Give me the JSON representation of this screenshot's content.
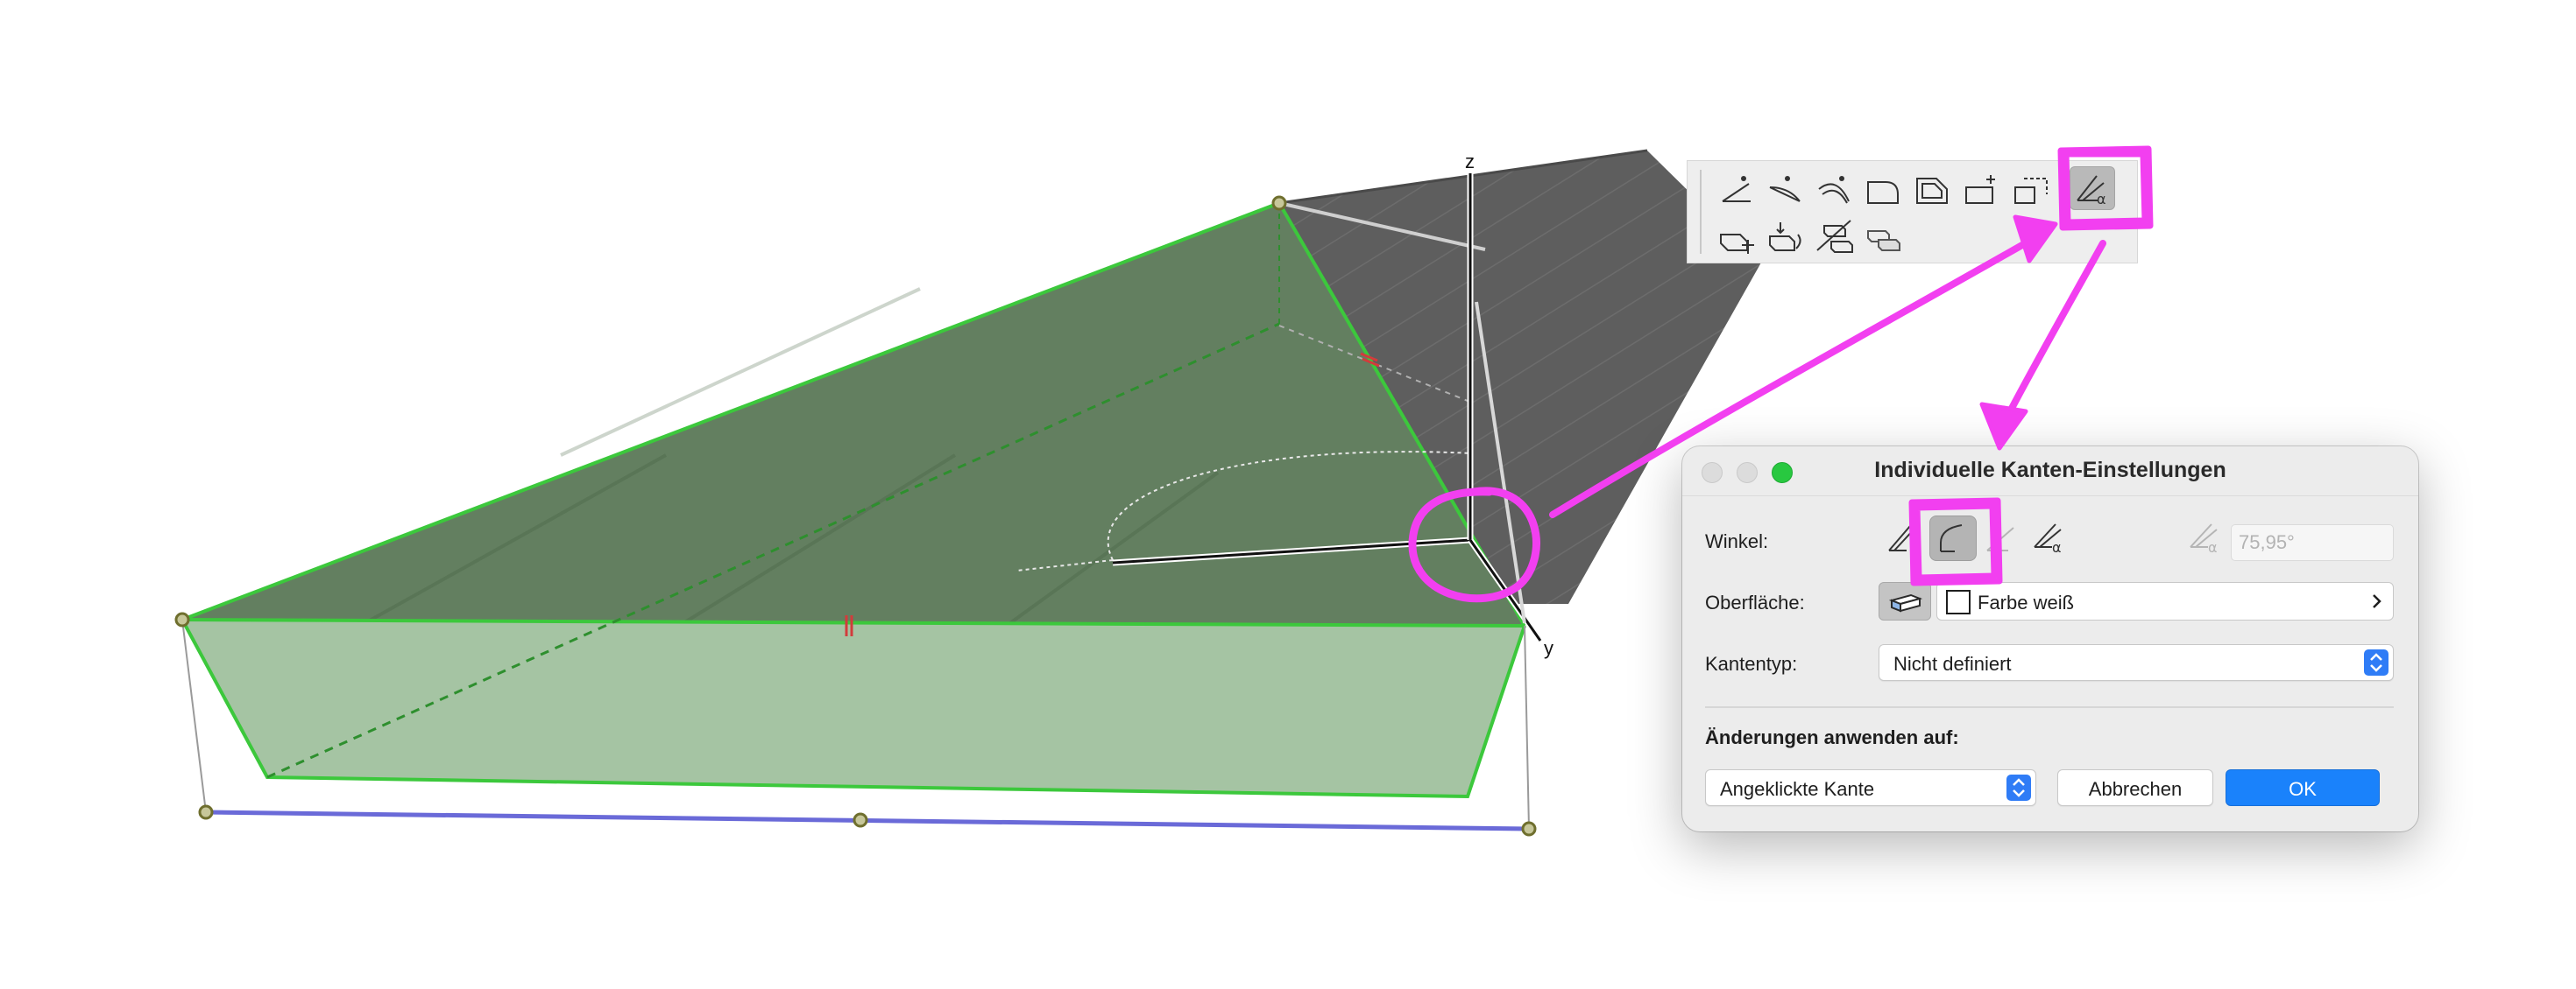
{
  "viewport": {
    "axes": {
      "z": "z",
      "y": "y"
    }
  },
  "toolbar": {
    "row1": [
      {
        "icon": "corner-point-icon"
      },
      {
        "icon": "edge-curve-icon"
      },
      {
        "icon": "edge-arc-icon"
      },
      {
        "icon": "rounded-corner-icon"
      },
      {
        "icon": "chamfer-icon"
      },
      {
        "icon": "offset-add-icon"
      },
      {
        "icon": "offset-dashed-icon"
      },
      {
        "icon": "custom-edge-angle-icon",
        "active": true
      }
    ],
    "row2": [
      {
        "icon": "move-node-icon"
      },
      {
        "icon": "rotate-node-icon"
      },
      {
        "icon": "split-slab-icon"
      },
      {
        "icon": "merge-slab-icon"
      }
    ]
  },
  "dialog": {
    "title": "Individuelle Kanten-Einstellungen",
    "angle_label": "Winkel:",
    "angle_options": [
      {
        "icon": "edge-vertical-icon",
        "active": false
      },
      {
        "icon": "edge-perpendicular-icon",
        "active": true
      },
      {
        "icon": "edge-horizontal-icon",
        "active": false
      },
      {
        "icon": "edge-custom-angle-icon",
        "active": false
      }
    ],
    "angle_value": "75,95°",
    "surface_label": "Oberfläche:",
    "surface_value": "Farbe weiß",
    "edge_type_label": "Kantentyp:",
    "edge_type_value": "Nicht definiert",
    "apply_section_title": "Änderungen anwenden auf:",
    "apply_to_value": "Angeklickte Kante",
    "cancel_label": "Abbrechen",
    "ok_label": "OK"
  },
  "colors": {
    "annotation": "#f23ff0",
    "slab_green": "#5f7f5d",
    "edge_green": "#3cc83c",
    "roof_gray": "#5f5f5f",
    "accent_blue": "#1a82fb"
  }
}
